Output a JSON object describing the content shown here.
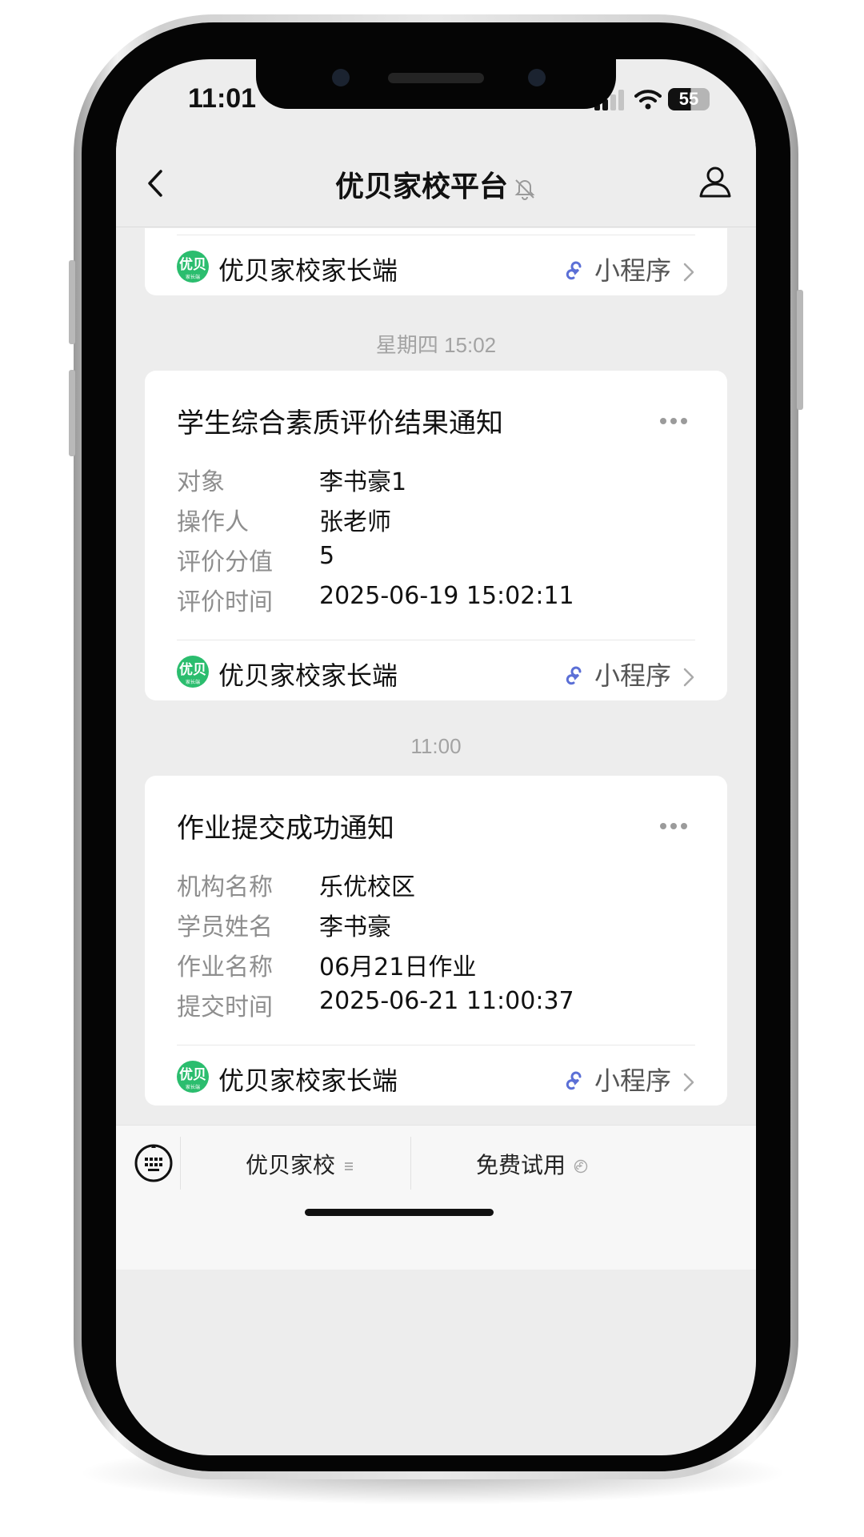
{
  "status_bar": {
    "time": "11:01",
    "battery": "55"
  },
  "header": {
    "title": "优贝家校平台",
    "icons": [
      "back-icon",
      "muted-bell-icon",
      "user-icon"
    ]
  },
  "colors": {
    "brand_green": "#2bbd6e",
    "link_blue": "#5b6fd6",
    "background": "#ededed"
  },
  "chat": {
    "top_card": {
      "miniprogram_name": "优贝家校家长端",
      "miniprogram_tag": "小程序",
      "logo_text": "优贝",
      "logo_subtext": "家长端"
    },
    "messages": [
      {
        "timestamp": "星期四 15:02",
        "title": "学生综合素质评价结果通知",
        "fields": [
          {
            "label": "对象",
            "value": "李书豪1"
          },
          {
            "label": "操作人",
            "value": "张老师"
          },
          {
            "label": "评价分值",
            "value": "5"
          },
          {
            "label": "评价时间",
            "value": "2025-06-19 15:02:11"
          }
        ],
        "miniprogram_name": "优贝家校家长端",
        "miniprogram_tag": "小程序",
        "logo_text": "优贝",
        "logo_subtext": "家长端"
      },
      {
        "timestamp": "11:00",
        "title": "作业提交成功通知",
        "fields": [
          {
            "label": "机构名称",
            "value": "乐优校区"
          },
          {
            "label": "学员姓名",
            "value": "李书豪"
          },
          {
            "label": "作业名称",
            "value": "06月21日作业"
          },
          {
            "label": "提交时间",
            "value": "2025-06-21 11:00:37"
          }
        ],
        "miniprogram_name": "优贝家校家长端",
        "miniprogram_tag": "小程序",
        "logo_text": "优贝",
        "logo_subtext": "家长端"
      }
    ]
  },
  "bottom_menu": {
    "items": [
      "优贝家校",
      "免费试用"
    ]
  }
}
